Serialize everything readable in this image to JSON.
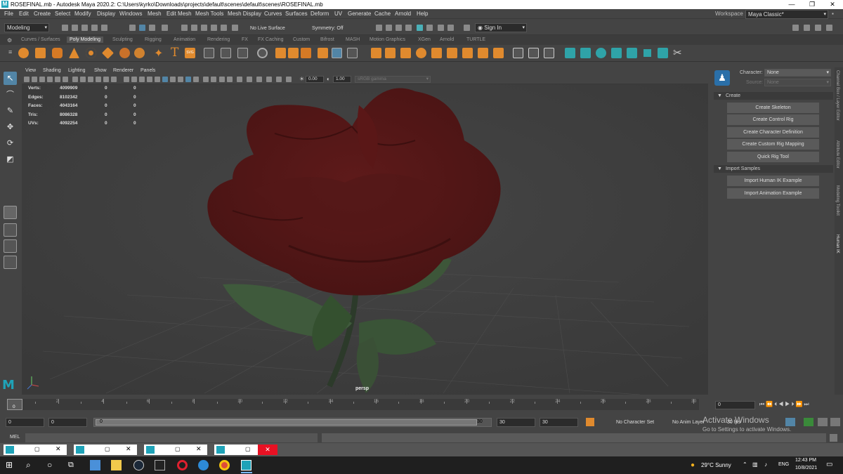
{
  "titlebar": {
    "title": "ROSEFINAL.mb - Autodesk Maya 2020.2: C:\\Users\\kyrko\\Downloads\\projects\\default\\scenes\\default\\scenes\\ROSEFINAL.mb",
    "logo": "M",
    "minimize_icon": "—",
    "maximize_icon": "❐",
    "close_icon": "✕"
  },
  "menubar": {
    "items": [
      "File",
      "Edit",
      "Create",
      "Select",
      "Modify",
      "Display",
      "Windows",
      "Mesh",
      "Edit Mesh",
      "Mesh Tools",
      "Mesh Display",
      "Curves",
      "Surfaces",
      "Deform",
      "UV",
      "Generate",
      "Cache",
      "Arnold",
      "Help"
    ],
    "workspace_label": "Workspace :",
    "workspace_value": "Maya Classic*"
  },
  "statusline": {
    "mode": "Modeling",
    "live_surface": "No Live Surface",
    "symmetry": "Symmetry: Off",
    "signin": "Sign In"
  },
  "shelf_tabs": [
    "Curves / Surfaces",
    "Poly Modeling",
    "Sculpting",
    "Rigging",
    "Animation",
    "Rendering",
    "FX",
    "FX Caching",
    "Custom",
    "Bifrost",
    "MASH",
    "Motion Graphics",
    "XGen",
    "Arnold",
    "TURTLE"
  ],
  "active_shelf_tab": "Poly Modeling",
  "viewport": {
    "menu": [
      "View",
      "Shading",
      "Lighting",
      "Show",
      "Renderer",
      "Panels"
    ],
    "exposure": "0.00",
    "gamma": "1.00",
    "colorspace": "sRGB gamma",
    "camera_label": "persp",
    "hud": [
      {
        "label": "Verts:",
        "v1": "4099909",
        "v2": "0",
        "v3": "0"
      },
      {
        "label": "Edges:",
        "v1": "8102342",
        "v2": "0",
        "v3": "0"
      },
      {
        "label": "Faces:",
        "v1": "4043164",
        "v2": "0",
        "v3": "0"
      },
      {
        "label": "Tris:",
        "v1": "8086328",
        "v2": "0",
        "v3": "0"
      },
      {
        "label": "UVs:",
        "v1": "4092254",
        "v2": "0",
        "v3": "0"
      }
    ]
  },
  "humanik": {
    "character_label": "Character:",
    "character_value": "None",
    "source_label": "Source:",
    "source_value": "None",
    "create_section": "Create",
    "create_buttons": [
      "Create Skeleton",
      "Create Control Rig",
      "Create Character Definition",
      "Create Custom Rig Mapping",
      "Quick Rig Tool"
    ],
    "import_section": "Import Samples",
    "import_buttons": [
      "Import Human IK Example",
      "Import Animation Example"
    ]
  },
  "side_tabs": [
    "Channel Box / Layer Editor",
    "Attribute Editor",
    "Modeling Toolkit",
    "Human IK"
  ],
  "timeslider": {
    "ticks": [
      "0",
      "2",
      "4",
      "6",
      "8",
      "10",
      "12",
      "14",
      "16",
      "18",
      "20",
      "22",
      "24",
      "26",
      "28",
      "30"
    ],
    "current_frame": "0",
    "current_frame_field": "0"
  },
  "rangebar": {
    "start": "0",
    "anim_start": "0",
    "range_start": "0",
    "range_end": "30",
    "anim_end": "30",
    "end": "30",
    "character_set": "No Character Set",
    "anim_layer": "No Anim Layer",
    "fps": "30 fps"
  },
  "watermark": {
    "line1": "Activate Windows",
    "line2": "Go to Settings to activate Windows."
  },
  "cmdline": {
    "label": "MEL"
  },
  "taskbar": {
    "weather": "29°C  Sunny",
    "lang": "ENG",
    "time": "12:43 PM",
    "date": "10/8/2021"
  },
  "colors": {
    "accent": "#5285a6",
    "maya_logo": "#1fa3b8",
    "rose": "#6e1c1c",
    "leaf": "#3f5a3c"
  }
}
